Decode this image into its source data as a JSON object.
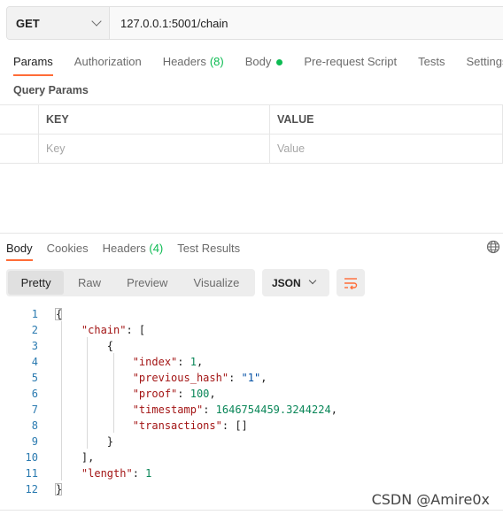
{
  "request": {
    "method": "GET",
    "url": "127.0.0.1:5001/chain"
  },
  "request_tabs": [
    {
      "label": "Params",
      "count": ""
    },
    {
      "label": "Authorization",
      "count": ""
    },
    {
      "label": "Headers",
      "count": "(8)"
    },
    {
      "label": "Body",
      "count": ""
    },
    {
      "label": "Pre-request Script",
      "count": ""
    },
    {
      "label": "Tests",
      "count": ""
    },
    {
      "label": "Settings",
      "count": ""
    }
  ],
  "query_params": {
    "title": "Query Params",
    "col_key": "KEY",
    "col_value": "VALUE",
    "key_placeholder": "Key",
    "value_placeholder": "Value"
  },
  "response_tabs": [
    {
      "label": "Body",
      "count": ""
    },
    {
      "label": "Cookies",
      "count": ""
    },
    {
      "label": "Headers",
      "count": "(4)"
    },
    {
      "label": "Test Results",
      "count": ""
    }
  ],
  "format_buttons": [
    "Pretty",
    "Raw",
    "Preview",
    "Visualize"
  ],
  "format_select": "JSON",
  "line_numbers": [
    "1",
    "2",
    "3",
    "4",
    "5",
    "6",
    "7",
    "8",
    "9",
    "10",
    "11",
    "12"
  ],
  "code": {
    "open": "{",
    "chain_key": "\"chain\"",
    "chain_open": ": [",
    "obj_open": "{",
    "index_key": "\"index\"",
    "index_val": "1",
    "prev_key": "\"previous_hash\"",
    "prev_val": "\"1\"",
    "proof_key": "\"proof\"",
    "proof_val": "100",
    "ts_key": "\"timestamp\"",
    "ts_val": "1646754459.3244224",
    "tx_key": "\"transactions\"",
    "tx_val": "[]",
    "obj_close": "}",
    "chain_close": "],",
    "length_key": "\"length\"",
    "length_val": "1",
    "close": "}"
  },
  "watermark": "CSDN @Amire0x",
  "colors": {
    "accent": "#ff6c37",
    "green": "#0cbb52",
    "json_key": "#a31515",
    "json_string": "#0451a5",
    "json_number": "#098658"
  }
}
